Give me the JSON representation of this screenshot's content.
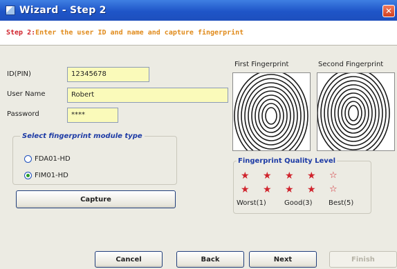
{
  "window": {
    "title": "Wizard - Step 2",
    "close_glyph": "✕"
  },
  "step": {
    "number": "Step 2:",
    "description": "Enter the user ID and name and capture fingerprint"
  },
  "form": {
    "id_label": "ID(PIN)",
    "id_value": "12345678",
    "name_label": "User Name",
    "name_value": "Robert",
    "password_label": "Password",
    "password_value": "****"
  },
  "module": {
    "legend": "Select fingerprint module type",
    "options": [
      {
        "label": "FDA01-HD",
        "selected": false
      },
      {
        "label": "FIM01-HD",
        "selected": true
      }
    ]
  },
  "capture_label": "Capture",
  "fingerprints": {
    "first_label": "First Fingerprint",
    "second_label": "Second Fingerprint"
  },
  "quality": {
    "legend": "Fingerprint  Quality Level",
    "rows": [
      {
        "filled": 4,
        "total": 5
      },
      {
        "filled": 4,
        "total": 5
      }
    ],
    "worst": "Worst(1)",
    "good": "Good(3)",
    "best": "Best(5)",
    "star_full_glyph": "★",
    "star_empty_glyph": "☆"
  },
  "buttons": {
    "cancel": "Cancel",
    "back": "Back",
    "next": "Next",
    "finish": "Finish"
  },
  "colors": {
    "title_bar": "#1f55c8",
    "step_red": "#d0232c",
    "step_orange": "#e08a1a",
    "legend_blue": "#1c3aa5",
    "field_yellow": "#fafaba"
  }
}
